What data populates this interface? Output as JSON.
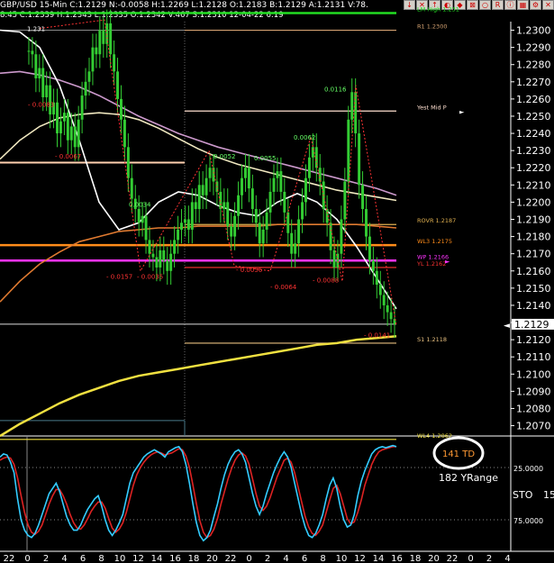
{
  "window": {
    "title": "GBP/USD 15-Min C:1.2129 N:-0.0058 H:1.2269 L:1.2128 O:1.2183 B:1.2129 A:1.2131 V:78.",
    "subtitle": "8:45 C:1.2339 H:1.2343 L:1.2335 O:1.2342 V:467 S:1.2310 12-04-22 6:19",
    "buttons": [
      "↓",
      "✕",
      "↑",
      "◐",
      "◆",
      "⊠",
      "○",
      "R",
      "ⓘ",
      "▦",
      "⚙",
      "✕"
    ]
  },
  "colors": {
    "background": "#000000",
    "candle": "#33cc33",
    "ma_pink": "#cc99cc",
    "ma_white": "#ffffff",
    "ma_cream": "#f0e8c0",
    "ma_orange": "#e07a30",
    "ma_yellow": "#f0e040",
    "wp_line": "#ff33ff",
    "l3_line": "#ff8c1a",
    "green_line": "#22dd22",
    "sto_k": "#33ccff",
    "sto_d": "#dd2222",
    "annot_red": "#ff3333",
    "annot_green": "#66ff66",
    "td_orange": "#ff9933"
  },
  "chart_data": {
    "type": "line",
    "title": "GBP/USD 15-Min",
    "price_axis": {
      "range": [
        1.2064,
        1.2305
      ],
      "ticks": [
        "1.2300",
        "1.2290",
        "1.2280",
        "1.2270",
        "1.2260",
        "1.2250",
        "1.2240",
        "1.2230",
        "1.2220",
        "1.2210",
        "1.2200",
        "1.2190",
        "1.2180",
        "1.2170",
        "1.2160",
        "1.2150",
        "1.2140",
        "1.2130",
        "1.2120",
        "1.2110",
        "1.2100",
        "1.2090",
        "1.2080",
        "1.2070"
      ]
    },
    "current_price": "1.2129",
    "levels": [
      {
        "name": "LM High",
        "label": "LM High 1.231",
        "value": 1.231,
        "color": "#22dd22"
      },
      {
        "name": "R1",
        "label": "R1 1.2300",
        "value": 1.23,
        "color": "#d2a070"
      },
      {
        "name": "Yest Mid P",
        "label": "Yest Mid P",
        "value": 1.2253,
        "color": "#ffe0d0"
      },
      {
        "name": "ROVR",
        "label": "ROVR 1.2187",
        "value": 1.2187,
        "color": "#e0b050"
      },
      {
        "name": "WL3",
        "label": "WL3 1.2175",
        "value": 1.2175,
        "color": "#ff8c1a"
      },
      {
        "name": "WP",
        "label": "WP 1.2166",
        "value": 1.2166,
        "color": "#ff33ff"
      },
      {
        "name": "YL",
        "label": "YL 1.2162",
        "value": 1.2162,
        "color": "#ff3333"
      },
      {
        "name": "S1",
        "label": "S1 1.2118",
        "value": 1.2118,
        "color": "#e8c080"
      },
      {
        "name": "WL4",
        "label": "WL4 1.2062",
        "value": 1.2062,
        "color": "#f0e040"
      }
    ],
    "swing_annotations": [
      {
        "text": "1.231",
        "t": 30,
        "price": 1.2301,
        "color": "#ffffff"
      },
      {
        "text": "- 0.0083",
        "t": 31,
        "price": 1.2257,
        "color": "#ff3333"
      },
      {
        "text": "- 0.0067",
        "t": 61,
        "price": 1.2227,
        "color": "#ff3333"
      },
      {
        "text": "0.0034",
        "t": 143,
        "price": 1.2199,
        "color": "#66ff66"
      },
      {
        "text": "- 0.0157",
        "t": 118,
        "price": 1.2157,
        "color": "#ff3333"
      },
      {
        "text": "- 0.0035",
        "t": 152,
        "price": 1.2157,
        "color": "#ff3333"
      },
      {
        "text": "0.0052",
        "t": 237,
        "price": 1.2227,
        "color": "#66ff66"
      },
      {
        "text": "0.0055",
        "t": 282,
        "price": 1.2226,
        "color": "#66ff66"
      },
      {
        "text": "- 0.0056",
        "t": 262,
        "price": 1.2161,
        "color": "#ff3333"
      },
      {
        "text": "0.0062",
        "t": 326,
        "price": 1.2238,
        "color": "#66ff66"
      },
      {
        "text": "- 0.0064",
        "t": 300,
        "price": 1.2151,
        "color": "#ff3333"
      },
      {
        "text": "0.0116",
        "t": 360,
        "price": 1.2266,
        "color": "#66ff66"
      },
      {
        "text": "- 0.0088",
        "t": 347,
        "price": 1.2155,
        "color": "#ff3333"
      },
      {
        "text": "- 0.0141",
        "t": 404,
        "price": 1.2123,
        "color": "#ff3333"
      }
    ],
    "candles_close": [
      1.2288,
      1.2286,
      1.2272,
      1.2278,
      1.2261,
      1.2268,
      1.2251,
      1.2258,
      1.224,
      1.2247,
      1.2252,
      1.2236,
      1.2244,
      1.2232,
      1.2248,
      1.2262,
      1.227,
      1.2276,
      1.229,
      1.2286,
      1.23,
      1.2292,
      1.2304,
      1.2286,
      1.2276,
      1.226,
      1.2248,
      1.2232,
      1.2214,
      1.2202,
      1.2196,
      1.2188,
      1.2192,
      1.2178,
      1.217,
      1.2168,
      1.2162,
      1.2172,
      1.2166,
      1.216,
      1.217,
      1.2178,
      1.2184,
      1.2188,
      1.219,
      1.2184,
      1.22,
      1.2196,
      1.221,
      1.2204,
      1.2214,
      1.222,
      1.2212,
      1.2206,
      1.2196,
      1.22,
      1.2186,
      1.218,
      1.2192,
      1.2204,
      1.2214,
      1.222,
      1.2208,
      1.2196,
      1.2188,
      1.2176,
      1.2184,
      1.2194,
      1.2206,
      1.2214,
      1.2218,
      1.2206,
      1.2194,
      1.2182,
      1.217,
      1.2176,
      1.219,
      1.22,
      1.2214,
      1.2226,
      1.2232,
      1.222,
      1.2212,
      1.2196,
      1.2188,
      1.2172,
      1.2162,
      1.217,
      1.219,
      1.2212,
      1.2248,
      1.2264,
      1.224,
      1.221,
      1.2196,
      1.218,
      1.2166,
      1.216,
      1.2152,
      1.2146,
      1.214,
      1.2136,
      1.2132,
      1.2129
    ],
    "moving_averages": [
      {
        "name": "pink",
        "color": "#cc99cc",
        "values": [
          1.2275,
          1.2276,
          1.2274,
          1.2271,
          1.2267,
          1.2262,
          1.2256,
          1.225,
          1.2245,
          1.224,
          1.2236,
          1.2232,
          1.2229,
          1.2226,
          1.2223,
          1.222,
          1.2217,
          1.2214,
          1.2211,
          1.2208,
          1.2204
        ]
      },
      {
        "name": "cream",
        "color": "#f0e8c0",
        "values": [
          1.2225,
          1.2236,
          1.2244,
          1.2249,
          1.2251,
          1.2252,
          1.2251,
          1.2248,
          1.2243,
          1.2237,
          1.2231,
          1.2226,
          1.2222,
          1.2219,
          1.2216,
          1.2213,
          1.221,
          1.2207,
          1.2205,
          1.2203,
          1.2201
        ]
      },
      {
        "name": "white",
        "color": "#ffffff",
        "values": [
          1.23,
          1.2299,
          1.229,
          1.2268,
          1.2236,
          1.22,
          1.2184,
          1.2188,
          1.22,
          1.2206,
          1.2204,
          1.2198,
          1.2194,
          1.2192,
          1.22,
          1.2205,
          1.22,
          1.219,
          1.2174,
          1.2156,
          1.2138
        ]
      },
      {
        "name": "orange",
        "color": "#e07a30",
        "values": [
          1.2142,
          1.2154,
          1.2164,
          1.2171,
          1.2177,
          1.218,
          1.2183,
          1.2184,
          1.2185,
          1.2185,
          1.2186,
          1.2186,
          1.2186,
          1.2186,
          1.2187,
          1.2187,
          1.2187,
          1.2187,
          1.2187,
          1.2186,
          1.2185
        ]
      },
      {
        "name": "yellow",
        "color": "#f0e040",
        "values": [
          1.2064,
          1.2071,
          1.2077,
          1.2083,
          1.2088,
          1.2092,
          1.2096,
          1.2099,
          1.2101,
          1.2103,
          1.2105,
          1.2107,
          1.2109,
          1.2111,
          1.2113,
          1.2115,
          1.2117,
          1.2118,
          1.212,
          1.2121,
          1.2122
        ]
      }
    ],
    "stochastic": {
      "label": "STO",
      "period": "15",
      "ticks": [
        "25.0000",
        "75.0000"
      ],
      "range": [
        0,
        100
      ],
      "k": [
        15,
        12,
        13,
        20,
        30,
        55,
        75,
        85,
        90,
        92,
        88,
        80,
        70,
        60,
        50,
        45,
        40,
        48,
        60,
        72,
        80,
        85,
        85,
        80,
        72,
        65,
        60,
        55,
        52,
        62,
        75,
        85,
        90,
        85,
        78,
        70,
        55,
        40,
        30,
        25,
        20,
        15,
        12,
        10,
        8,
        10,
        12,
        15,
        10,
        8,
        6,
        5,
        10,
        22,
        40,
        60,
        78,
        90,
        95,
        92,
        85,
        72,
        60,
        45,
        32,
        22,
        15,
        10,
        8,
        12,
        20,
        35,
        50,
        62,
        70,
        62,
        50,
        40,
        30,
        22,
        15,
        10,
        15,
        25,
        40,
        55,
        70,
        82,
        90,
        92,
        88,
        80,
        70,
        55,
        42,
        35,
        45,
        62,
        75,
        82,
        80,
        70,
        52,
        38,
        28,
        20,
        12,
        8,
        6,
        5,
        6,
        5,
        4,
        5
      ],
      "d": [
        18,
        16,
        15,
        16,
        22,
        35,
        52,
        68,
        80,
        87,
        89,
        86,
        80,
        70,
        60,
        52,
        46,
        46,
        52,
        60,
        70,
        78,
        83,
        84,
        80,
        74,
        67,
        62,
        58,
        58,
        64,
        74,
        83,
        87,
        84,
        78,
        68,
        55,
        42,
        32,
        25,
        20,
        16,
        13,
        11,
        10,
        11,
        13,
        12,
        11,
        9,
        7,
        8,
        14,
        25,
        42,
        60,
        76,
        87,
        92,
        90,
        84,
        74,
        60,
        48,
        36,
        26,
        18,
        13,
        11,
        14,
        22,
        36,
        50,
        62,
        66,
        62,
        54,
        44,
        34,
        26,
        18,
        16,
        20,
        30,
        44,
        58,
        72,
        82,
        88,
        90,
        86,
        80,
        68,
        56,
        45,
        42,
        50,
        62,
        74,
        79,
        77,
        68,
        56,
        42,
        32,
        22,
        15,
        10,
        8,
        7,
        6,
        5,
        5
      ]
    },
    "time_labels": [
      "22",
      "0",
      "2",
      "4",
      "6",
      "8",
      "10",
      "12",
      "14",
      "16",
      "18",
      "20",
      "22",
      "0",
      "2",
      "4",
      "6",
      "8",
      "10",
      "12",
      "14",
      "16",
      "18",
      "20",
      "22",
      "0",
      "2",
      "4"
    ],
    "badge": {
      "value": "141 TD",
      "subtext": "182 YRange"
    }
  }
}
